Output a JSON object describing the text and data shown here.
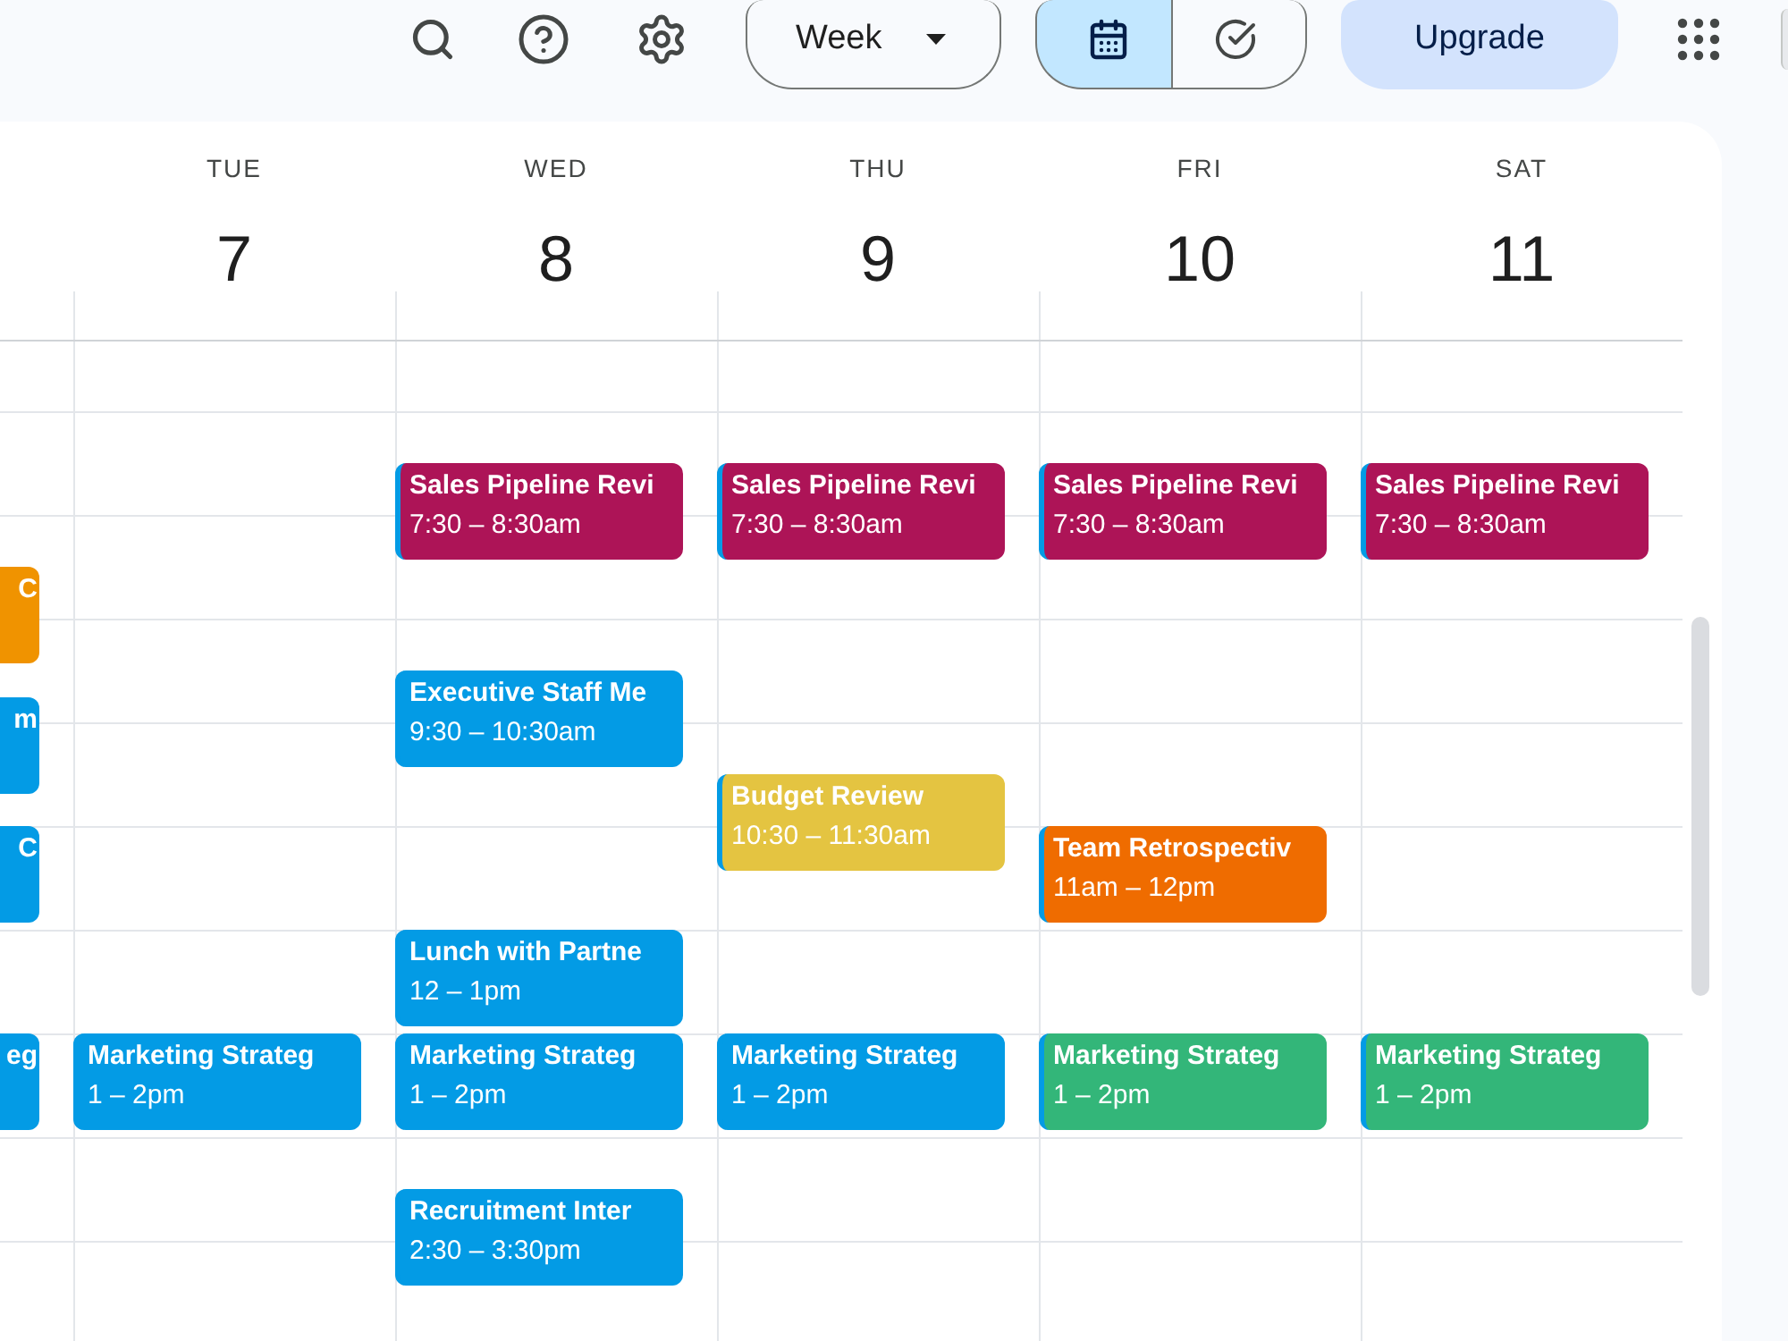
{
  "toolbar": {
    "view_select": "Week",
    "view_toggle": [
      {
        "kind": "calendar",
        "selected": true
      },
      {
        "kind": "tasks",
        "selected": false
      }
    ],
    "upgrade_button": "Upgrade"
  },
  "days": [
    {
      "kind": "partial",
      "events": [
        {
          "title": "C",
          "color": "#f09300"
        },
        {
          "title": "m",
          "color": "#039be5"
        },
        {
          "title": "C",
          "color": "#039be5"
        },
        {
          "title": "eg",
          "color": "#039be5"
        }
      ]
    },
    {
      "kind": "day",
      "name": "TUE",
      "number": "7",
      "events": [
        {
          "title": "Marketing Strateg",
          "time": "1 – 2pm",
          "color": "#039be5"
        }
      ]
    },
    {
      "kind": "day",
      "name": "WED",
      "number": "8",
      "events": [
        {
          "title": "Sales Pipeline Revi",
          "time": "7:30 – 8:30am",
          "color": "#ad1457"
        },
        {
          "title": "Executive Staff Me",
          "time": "9:30 – 10:30am",
          "color": "#039be5"
        },
        {
          "title": "Lunch with Partne",
          "time": "12 – 1pm",
          "color": "#039be5"
        },
        {
          "title": "Marketing Strateg",
          "time": "1 – 2pm",
          "color": "#039be5"
        },
        {
          "title": "Recruitment Inter",
          "time": "2:30 – 3:30pm",
          "color": "#039be5"
        }
      ]
    },
    {
      "kind": "day",
      "name": "THU",
      "number": "9",
      "events": [
        {
          "title": "Sales Pipeline Revi",
          "time": "7:30 – 8:30am",
          "color": "#ad1457"
        },
        {
          "title": "Budget Review",
          "time": "10:30 – 11:30am",
          "color": "#e4c441"
        },
        {
          "title": "Marketing Strateg",
          "time": "1 – 2pm",
          "color": "#039be5"
        }
      ]
    },
    {
      "kind": "day",
      "name": "FRI",
      "number": "10",
      "events": [
        {
          "title": "Sales Pipeline Revi",
          "time": "7:30 – 8:30am",
          "color": "#ad1457"
        },
        {
          "title": "Team Retrospectiv",
          "time": "11am – 12pm",
          "color": "#ef6c00"
        },
        {
          "title": "Marketing Strateg",
          "time": "1 – 2pm",
          "color": "#33b679"
        }
      ]
    },
    {
      "kind": "day",
      "name": "SAT",
      "number": "11",
      "events": [
        {
          "title": "Sales Pipeline Revi",
          "time": "7:30 – 8:30am",
          "color": "#ad1457"
        },
        {
          "title": "Marketing Strateg",
          "time": "1 – 2pm",
          "color": "#33b679"
        }
      ]
    }
  ]
}
